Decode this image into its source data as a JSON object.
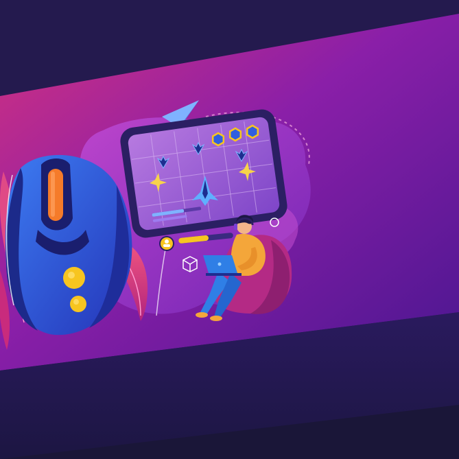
{
  "illustration": {
    "subject": "",
    "colors": {
      "background": "#241a4e",
      "banner_top": "#d4317f",
      "banner_mid": "#8a1fa8",
      "banner_bottom": "#5a189a",
      "mouse_body": "#2f5fe0",
      "mouse_dark": "#1a1e6e",
      "mouse_accent": "#f57b2a",
      "button_yellow": "#f7c520",
      "screen_bg": "#9a5bd6",
      "screen_frame": "#2b1f63",
      "player_shirt": "#f4a63a",
      "player_pants": "#2f7fe6",
      "beanbag": "#b42a85"
    },
    "game_screen": {
      "enemy_count": 3,
      "hexagon_count": 3,
      "player_ship_count": 1,
      "health_bar_fill": 0.65
    },
    "progress_bar_fill": 0.55
  }
}
